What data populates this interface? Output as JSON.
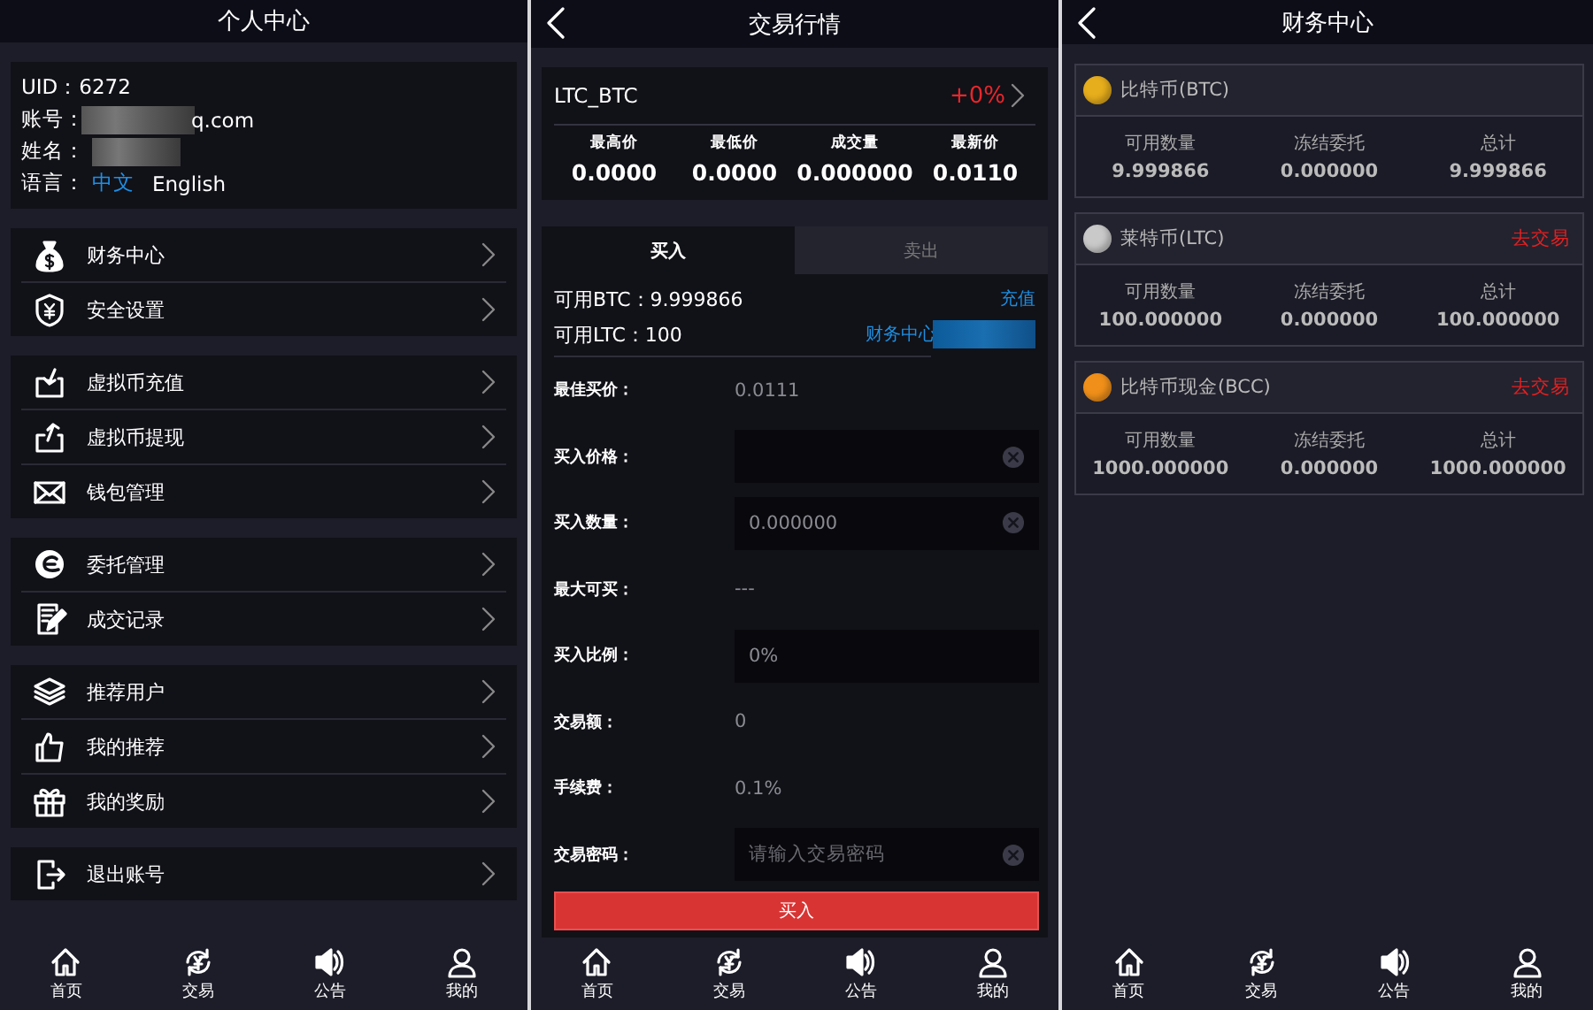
{
  "profile": {
    "title": "个人中心",
    "info": {
      "uid": "UID：6272",
      "account_label": "账号：",
      "account": "q.com",
      "name_label": "姓名：",
      "language_label": "语言：",
      "languages": [
        {
          "label": "中文",
          "selected": true
        },
        {
          "label": "English",
          "selected": false
        }
      ]
    },
    "menu_groups": [
      {
        "items": [
          {
            "label": "财务中心"
          },
          {
            "label": "安全设置"
          }
        ]
      },
      {
        "items": [
          {
            "label": "虚拟币充值"
          },
          {
            "label": "虚拟币提现"
          },
          {
            "label": "钱包管理"
          }
        ]
      },
      {
        "items": [
          {
            "label": "委托管理"
          },
          {
            "label": "成交记录"
          }
        ]
      },
      {
        "items": [
          {
            "label": "推荐用户"
          },
          {
            "label": "我的推荐"
          },
          {
            "label": "我的奖励"
          }
        ]
      },
      {
        "items": [
          {
            "label": "退出账号"
          }
        ]
      }
    ],
    "tab_bar": [
      {
        "label": "首页"
      },
      {
        "label": "交易"
      },
      {
        "label": "公告"
      },
      {
        "label": "我的"
      }
    ]
  },
  "trade": {
    "title": "交易行情",
    "pair": {
      "name": "LTC_BTC",
      "change": "+0%",
      "stats": [
        {
          "label": "最高价",
          "value": "0.0000"
        },
        {
          "label": "最低价",
          "value": "0.0000"
        },
        {
          "label": "成交量",
          "value": "0.000000"
        },
        {
          "label": "最新价",
          "value": "0.0110"
        }
      ]
    },
    "tabs": [
      {
        "label": "买入",
        "selected": true
      },
      {
        "label": "卖出",
        "selected": false
      }
    ],
    "balances": [
      {
        "text": "可用BTC：9.999866",
        "link": "充值"
      },
      {
        "text": "可用LTC：100",
        "link": "财务中心"
      }
    ],
    "form": [
      {
        "kind": "value",
        "label": "最佳买价：",
        "value": "0.0111"
      },
      {
        "kind": "input",
        "label": "买入价格：",
        "clearable": true
      },
      {
        "kind": "input",
        "label": "买入数量：",
        "value": "0.000000",
        "clearable": true
      },
      {
        "kind": "value",
        "label": "最大可买：",
        "value": "---"
      },
      {
        "kind": "input",
        "label": "买入比例：",
        "value": "0%",
        "clearable": false
      },
      {
        "kind": "value",
        "label": "交易额：",
        "value": "0"
      },
      {
        "kind": "value",
        "label": "手续费：",
        "value": "0.1%"
      },
      {
        "kind": "input",
        "label": "交易密码：",
        "placeholder": "请输入交易密码",
        "clearable": true
      }
    ],
    "submit": "买入",
    "tab_bar": [
      {
        "label": "首页"
      },
      {
        "label": "交易"
      },
      {
        "label": "公告"
      },
      {
        "label": "我的"
      }
    ]
  },
  "finance": {
    "title": "财务中心",
    "coins": [
      {
        "name": "比特币(BTC)",
        "color": "#e6ad1c",
        "columns": [
          {
            "label": "可用数量",
            "value": "9.999866"
          },
          {
            "label": "冻结委托",
            "value": "0.000000"
          },
          {
            "label": "总计",
            "value": "9.999866"
          }
        ]
      },
      {
        "name": "莱特币(LTC)",
        "color": "#c9c9c9",
        "action": "去交易",
        "columns": [
          {
            "label": "可用数量",
            "value": "100.000000"
          },
          {
            "label": "冻结委托",
            "value": "0.000000"
          },
          {
            "label": "总计",
            "value": "100.000000"
          }
        ]
      },
      {
        "name": "比特币现金(BCC)",
        "color": "#f0901a",
        "action": "去交易",
        "columns": [
          {
            "label": "可用数量",
            "value": "1000.000000"
          },
          {
            "label": "冻结委托",
            "value": "0.000000"
          },
          {
            "label": "总计",
            "value": "1000.000000"
          }
        ]
      }
    ],
    "tab_bar": [
      {
        "label": "首页"
      },
      {
        "label": "交易"
      },
      {
        "label": "公告"
      },
      {
        "label": "我的"
      }
    ]
  }
}
